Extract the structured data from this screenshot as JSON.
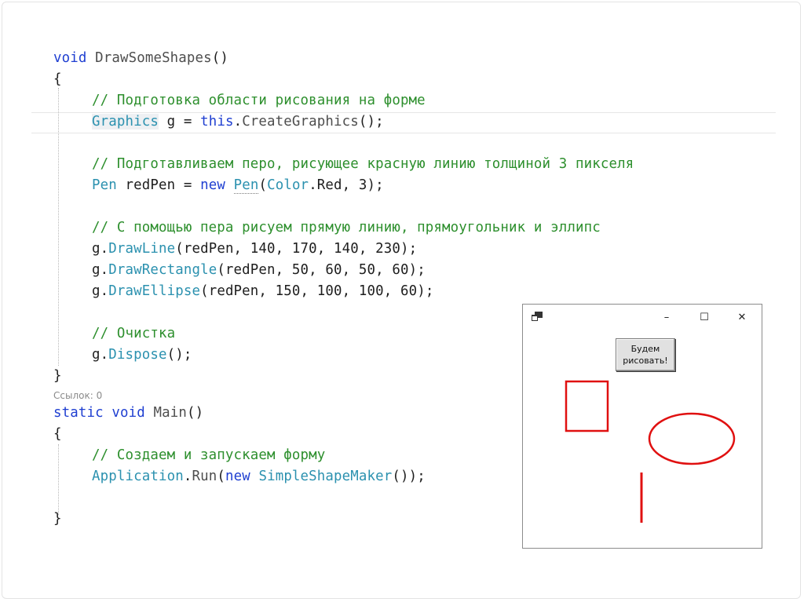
{
  "editor": {
    "code_lens_label": "Ссылок: 0",
    "lines": {
      "l1": {
        "kw": "void",
        "name": " DrawSomeShapes",
        "rest": "()"
      },
      "l2": "{",
      "l3": "// Подготовка области рисования на форме",
      "l4": {
        "type": "Graphics",
        "mid": " g = ",
        "kw": "this",
        "dot": ".",
        "fn": "CreateGraphics",
        "rest": "();"
      },
      "l6": "// Подготавливаем перо, рисующее красную линию толщиной 3 пикселя",
      "l7": {
        "type": "Pen",
        "mid": " redPen = ",
        "kw": "new",
        "sp": " ",
        "type2": "Pen",
        "p1": "(",
        "type3": "Color",
        "rest": ".Red, 3);"
      },
      "l9": "// С помощью пера рисуем прямую линию, прямоугольник и эллипс",
      "l10": {
        "obj": "g.",
        "fn": "DrawLine",
        "rest": "(redPen, 140, 170, 140, 230);"
      },
      "l11": {
        "obj": "g.",
        "fn": "DrawRectangle",
        "rest": "(redPen, 50, 60, 50, 60);"
      },
      "l12": {
        "obj": "g.",
        "fn": "DrawEllipse",
        "rest": "(redPen, 150, 100, 100, 60);"
      },
      "l14": "// Очистка",
      "l15": {
        "obj": "g.",
        "fn": "Dispose",
        "rest": "();"
      },
      "l16": "}",
      "l17": {
        "kw1": "static",
        "kw2": "void",
        "name": " Main",
        "rest": "()"
      },
      "l18": "{",
      "l19": "// Создаем и запускаем форму",
      "l20": {
        "type": "Application",
        "dot": ".",
        "fn": "Run",
        "p1": "(",
        "kw": "new",
        "sp": " ",
        "type2": "SimpleShapeMaker",
        "rest": "());"
      },
      "l22": "}"
    }
  },
  "form_window": {
    "minimize_glyph": "–",
    "maximize_glyph": "☐",
    "close_glyph": "✕",
    "button_line1": "Будем",
    "button_line2": "рисовать!",
    "shape_color": "#e01010"
  },
  "colors": {
    "keyword": "#1f3fd1",
    "type": "#2b91af",
    "comment": "#2d8f2d",
    "shape_red": "#e01010"
  }
}
